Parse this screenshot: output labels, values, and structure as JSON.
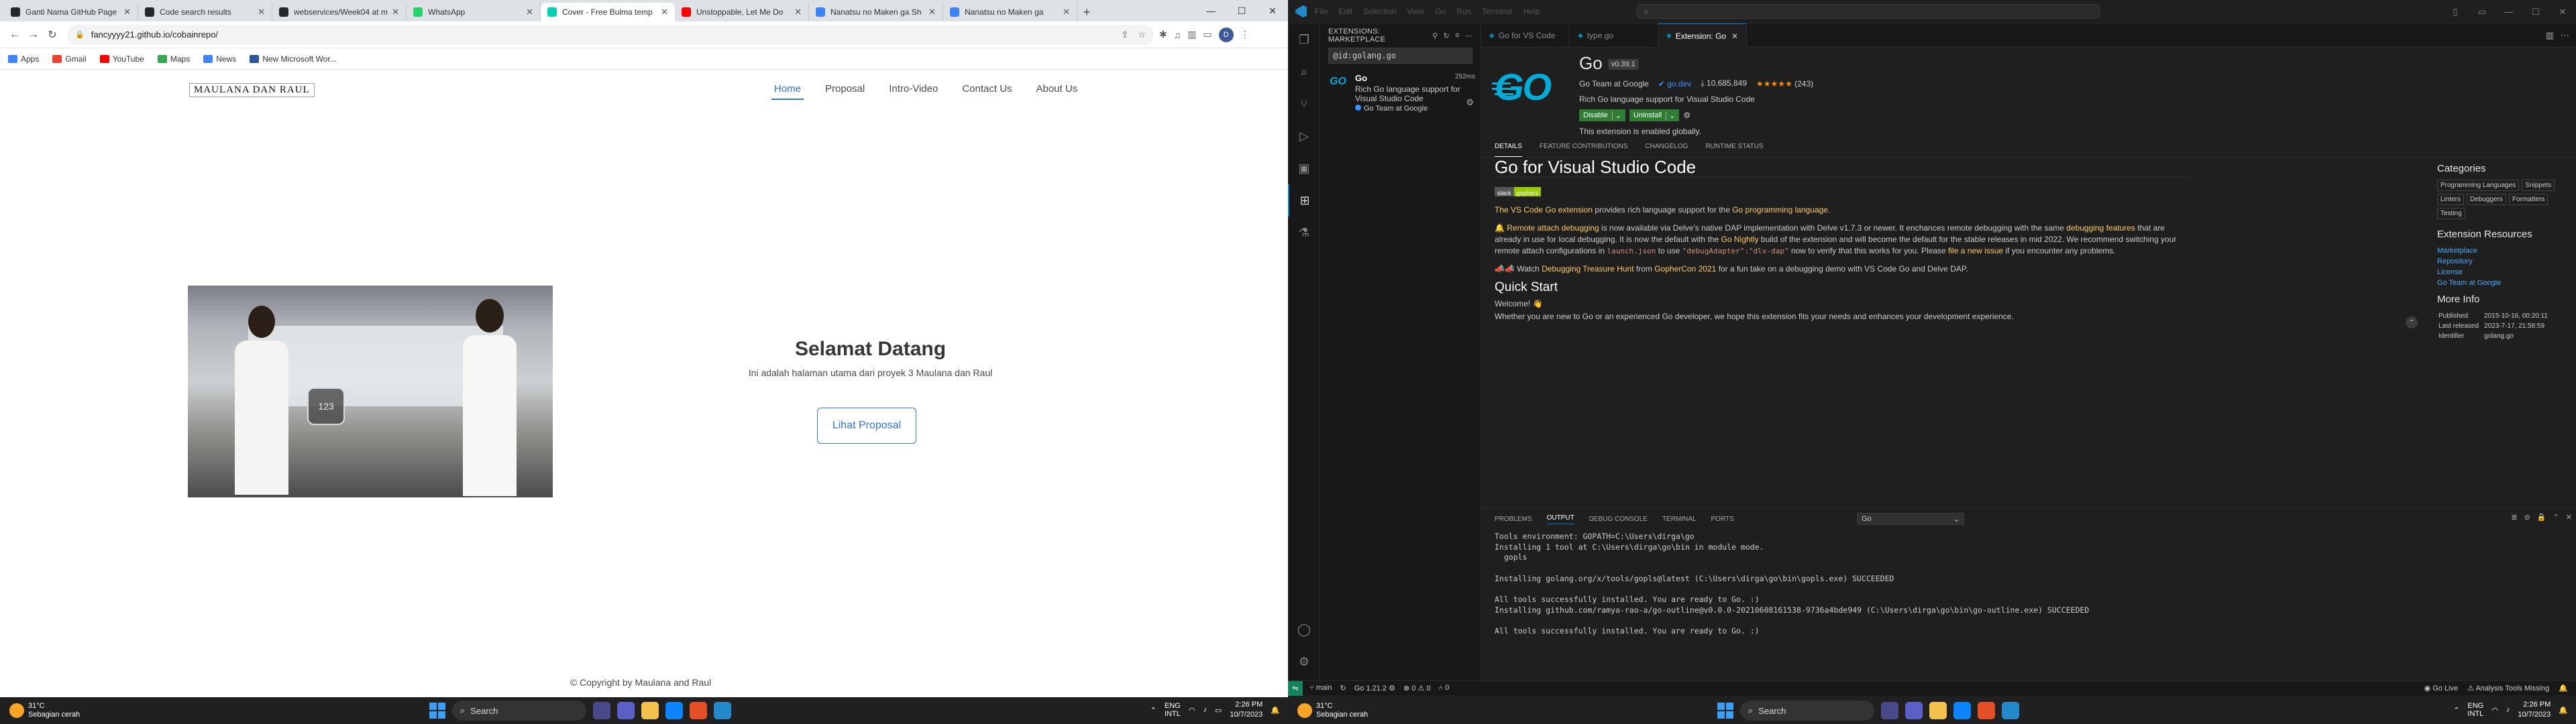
{
  "browser": {
    "tabs": [
      {
        "title": "Ganti Nama GitHub Page",
        "color": "#24292e"
      },
      {
        "title": "Code search results",
        "color": "#24292e"
      },
      {
        "title": "webservices/Week04 at m",
        "color": "#24292e"
      },
      {
        "title": "WhatsApp",
        "color": "#25d366"
      },
      {
        "title": "Cover - Free Bulma temp",
        "color": "#00d1b2",
        "active": true
      },
      {
        "title": "Unstoppable, Let Me Do",
        "color": "#ff0000"
      },
      {
        "title": "Nanatsu no Maken ga Sh",
        "color": "#3b82f6"
      },
      {
        "title": "Nanatsu no Maken ga",
        "color": "#3b82f6"
      }
    ],
    "url": "fancyyyy21.github.io/cobainrepo/",
    "bookmarks": [
      {
        "label": "Apps",
        "color": "#4285f4"
      },
      {
        "label": "Gmail",
        "color": "#ea4335"
      },
      {
        "label": "YouTube",
        "color": "#ff0000"
      },
      {
        "label": "Maps",
        "color": "#34a853"
      },
      {
        "label": "News",
        "color": "#4285f4"
      },
      {
        "label": "New Microsoft Wor...",
        "color": "#2b579a"
      }
    ]
  },
  "site": {
    "brand": "MAULANA DAN RAUL",
    "nav": [
      "Home",
      "Proposal",
      "Intro-Video",
      "Contact Us",
      "About Us"
    ],
    "photo_badge": "123",
    "hero_title": "Selamat Datang",
    "hero_subtitle": "Ini adalah halaman utama dari proyek 3 Maulana dan Raul",
    "hero_button": "Lihat Proposal",
    "footer": "© Copyright by Maulana and Raul"
  },
  "taskbar": {
    "temp": "31°C",
    "weather": "Sebagian cerah",
    "search": "Search",
    "lang1": "ENG",
    "lang2": "INTL",
    "time": "2:26 PM",
    "date": "10/7/2023"
  },
  "vscode": {
    "menu": [
      "File",
      "Edit",
      "Selection",
      "View",
      "Go",
      "Run",
      "Terminal",
      "Help"
    ],
    "sidebar_title": "EXTENSIONS: MARKETPLACE",
    "search_value": "@id:golang.go",
    "ext_item": {
      "name": "Go",
      "desc": "Rich Go language support for Visual Studio Code",
      "publisher": "Go Team at Google",
      "time": "292ms"
    },
    "editor_tabs": [
      "Go for VS Code",
      "type.go",
      "Extension: Go"
    ],
    "ext": {
      "title": "Go",
      "version": "v0.39.1",
      "publisher": "Go Team at Google",
      "domain": "go.dev",
      "installs": "10,685,849",
      "stars": "★★★★★",
      "ratings": "(243)",
      "desc": "Rich Go language support for Visual Studio Code",
      "btn_disable": "Disable",
      "btn_uninstall": "Uninstall",
      "enabled": "This extension is enabled globally."
    },
    "subtabs": [
      "DETAILS",
      "FEATURE CONTRIBUTIONS",
      "CHANGELOG",
      "RUNTIME STATUS"
    ],
    "readme": {
      "h1": "Go for Visual Studio Code",
      "badge_a": "slack",
      "badge_b": "gophers",
      "p1a": "The VS Code Go extension",
      "p1b": " provides rich language support for the ",
      "p1c": "Go programming language",
      "p2a": "🔔 ",
      "p2b": "Remote attach debugging",
      "p2c": " is now available via Delve's native DAP implementation with Delve v1.7.3 or newer. It enchances remote debugging with the same ",
      "p2d": "debugging features",
      "p2e": " that are already in use for local debugging. It is now the default with the ",
      "p2f": "Go Nightly",
      "p2g": " build of the extension and will become the default for the stable releases in mid 2022. We recommend switching your remote attach configurations in ",
      "p2h": "launch.json",
      "p2i": " to use ",
      "p2j": "\"debugAdapter\":\"dlv-dap\"",
      "p2k": " now to verify that this works for you. Please ",
      "p2l": "file a new issue",
      "p2m": " if you encounter any problems.",
      "p3a": "📣📣 Watch ",
      "p3b": "Debugging Treasure Hunt",
      "p3c": " from ",
      "p3d": "GopherCon 2021",
      "p3e": " for a fun take on a debugging demo with VS Code Go and Delve DAP.",
      "h2": "Quick Start",
      "p4": "Welcome! 👋",
      "p5": "Whether you are new to Go or an experienced Go developer, we hope this extension fits your needs and enhances your development experience."
    },
    "side": {
      "categories_title": "Categories",
      "categories": [
        "Programming Languages",
        "Snippets",
        "Linters",
        "Debuggers",
        "Formatters",
        "Testing"
      ],
      "resources_title": "Extension Resources",
      "resources": [
        "Marketplace",
        "Repository",
        "License",
        "Go Team at Google"
      ],
      "more_title": "More Info",
      "info": [
        {
          "k": "Published",
          "v": "2015-10-16, 00:20:11"
        },
        {
          "k": "Last released",
          "v": "2023-7-17, 21:58:59"
        },
        {
          "k": "Identifier",
          "v": "golang.go"
        }
      ]
    },
    "panel_tabs": [
      "PROBLEMS",
      "OUTPUT",
      "DEBUG CONSOLE",
      "TERMINAL",
      "PORTS"
    ],
    "panel_select": "Go",
    "output": [
      "Tools environment: GOPATH=C:\\Users\\dirga\\go",
      "Installing 1 tool at C:\\Users\\dirga\\go\\bin in module mode.",
      "  gopls",
      "",
      "Installing golang.org/x/tools/gopls@latest (C:\\Users\\dirga\\go\\bin\\gopls.exe) SUCCEEDED",
      "",
      "All tools successfully installed. You are ready to Go. :)",
      "Installing github.com/ramya-rao-a/go-outline@v0.0.0-20210608161538-9736a4bde949 (C:\\Users\\dirga\\go\\bin\\go-outline.exe) SUCCEEDED",
      "",
      "All tools successfully installed. You are ready to Go. :)"
    ],
    "status": {
      "branch": "main",
      "go_ver": "Go 1.21.2",
      "errors": "0",
      "warnings": "0",
      "ports": "0",
      "golive": "Go Live",
      "analysis": "Analysis Tools Missing"
    }
  }
}
